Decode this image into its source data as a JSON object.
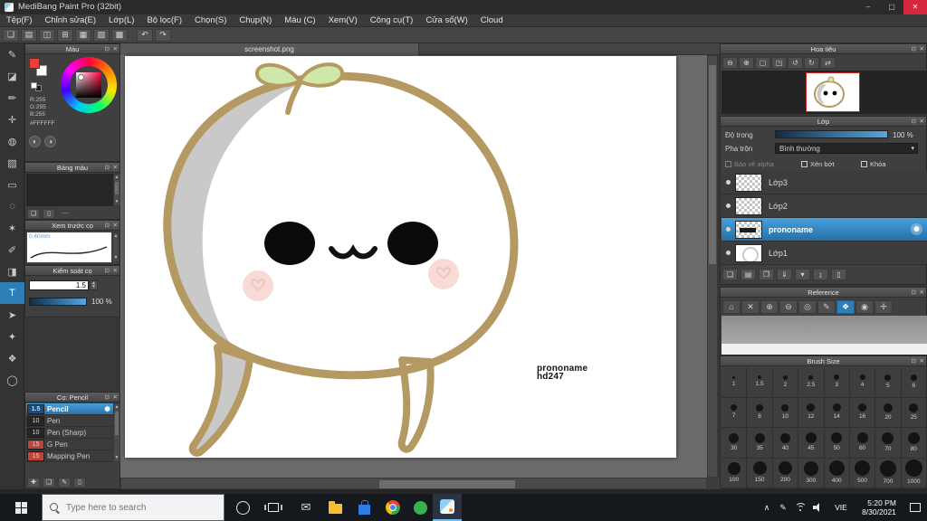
{
  "window": {
    "title": "MediBang Paint Pro (32bit)"
  },
  "icons": {
    "minimize": "–",
    "maximize": "▢",
    "close": "✕",
    "undo": "↶",
    "redo": "↷",
    "panel_float": "⊡",
    "panel_close": "✕",
    "gear": "✺",
    "dropdown": "▾",
    "scroll_up": "▲",
    "scroll_down": "▼",
    "color_wheel_mode": "◐",
    "color_bar_mode": "◑",
    "mail": "✉",
    "tray_expand": "∧",
    "tray_pen": "✎"
  },
  "menu_bar": {
    "items": [
      "Tệp(F)",
      "Chỉnh sửa(E)",
      "Lớp(L)",
      "Bộ lọc(F)",
      "Chọn(S)",
      "Chụp(N)",
      "Màu (C)",
      "Xem(V)",
      "Công cụ(T)",
      "Cửa sổ(W)",
      "Cloud"
    ]
  },
  "main_toolbar": {
    "icons": [
      {
        "name": "new-canvas-icon",
        "glyph": "❏"
      },
      {
        "name": "open-file-icon",
        "glyph": "▤"
      },
      {
        "name": "save-file-icon",
        "glyph": "◫"
      },
      {
        "name": "canvas-size-icon",
        "glyph": "⊞"
      },
      {
        "name": "grid-view-icon",
        "glyph": "▦"
      },
      {
        "name": "snap-grid-icon",
        "glyph": "▨"
      },
      {
        "name": "material-panel-icon",
        "glyph": "▩"
      }
    ]
  },
  "tools": {
    "items": [
      {
        "name": "brush-tool",
        "glyph": "✎"
      },
      {
        "name": "eraser-tool",
        "glyph": "◪"
      },
      {
        "name": "pen-tool",
        "glyph": "✏"
      },
      {
        "name": "move-tool",
        "glyph": "✛"
      },
      {
        "name": "fill-tool",
        "glyph": "◍"
      },
      {
        "name": "gradient-tool",
        "glyph": "▨"
      },
      {
        "name": "select-rect-tool",
        "glyph": "▭"
      },
      {
        "name": "lasso-tool",
        "glyph": "◌"
      },
      {
        "name": "magic-wand-tool",
        "glyph": "✶"
      },
      {
        "name": "select-pen-tool",
        "glyph": "✐"
      },
      {
        "name": "select-eraser-tool",
        "glyph": "◨"
      },
      {
        "name": "text-tool",
        "glyph": "T",
        "selected": true
      },
      {
        "name": "operation-tool",
        "glyph": "➤"
      },
      {
        "name": "eyedropper-tool",
        "glyph": "✦"
      },
      {
        "name": "hand-tool",
        "glyph": "❖"
      },
      {
        "name": "zoom-tool",
        "glyph": "◯"
      }
    ]
  },
  "color_panel": {
    "title": "Màu",
    "r": "R:255",
    "g": "G:255",
    "b": "B:255",
    "hex": "#FFFFFF"
  },
  "palette_panel": {
    "title": "Bảng màu",
    "empty_label": "---",
    "buttons": [
      {
        "name": "add-color-icon",
        "glyph": "❏"
      },
      {
        "name": "delete-color-icon",
        "glyph": "▯"
      }
    ]
  },
  "brush_preview_panel": {
    "title": "Xem trước cọ",
    "size_label": "0.40mm"
  },
  "brush_control_panel": {
    "title": "Kiểm soát cọ",
    "width_value": "1.5",
    "opacity_value": "100 %"
  },
  "brush_panel": {
    "title": "Cọ: Pencil",
    "brushes": [
      {
        "size": "1.5",
        "name": "Pencil",
        "selected": true,
        "chip": "#1c4e77"
      },
      {
        "size": "10",
        "name": "Pen",
        "chip": "#262626"
      },
      {
        "size": "10",
        "name": "Pen (Sharp)",
        "chip": "#262626"
      },
      {
        "size": "15",
        "name": "G Pen",
        "chip": "#c14438"
      },
      {
        "size": "15",
        "name": "Mapping Pen",
        "chip": "#c14438"
      }
    ],
    "buttons": [
      {
        "name": "add-brush-icon",
        "glyph": "✚"
      },
      {
        "name": "duplicate-brush-icon",
        "glyph": "❏"
      },
      {
        "name": "edit-brush-icon",
        "glyph": "✎"
      },
      {
        "name": "delete-brush-icon",
        "glyph": "▯"
      }
    ]
  },
  "canvas": {
    "tab": "screenshot.png",
    "signature_line1": "prononame",
    "signature_line2": "hd247"
  },
  "navigator_panel": {
    "title": "Hoa tiêu",
    "buttons": [
      {
        "name": "zoom-out-icon",
        "glyph": "⊖"
      },
      {
        "name": "zoom-in-icon",
        "glyph": "⊕"
      },
      {
        "name": "fit-window-icon",
        "glyph": "▢"
      },
      {
        "name": "actual-pixels-icon",
        "glyph": "◳"
      },
      {
        "name": "rotate-left-icon",
        "glyph": "↺"
      },
      {
        "name": "rotate-right-icon",
        "glyph": "↻"
      },
      {
        "name": "flip-horizontal-icon",
        "glyph": "⇄"
      }
    ]
  },
  "layer_panel": {
    "title": "Lớp",
    "opacity_label": "Độ trong",
    "opacity_value": "100 %",
    "blend_label": "Pha trộn",
    "blend_value": "Bình thường",
    "protect_alpha_label": "Bảo vệ alpha",
    "clipping_label": "Xén bớt",
    "lock_label": "Khóa",
    "layers": [
      {
        "name": "Lớp3",
        "thumb": "checker"
      },
      {
        "name": "Lớp2",
        "thumb": "checker"
      },
      {
        "name": "prononame",
        "thumb": "checker-ink",
        "selected": true
      },
      {
        "name": "Lớp1",
        "thumb": "sketch"
      }
    ],
    "buttons": [
      {
        "name": "add-layer-icon",
        "glyph": "❏"
      },
      {
        "name": "add-folder-icon",
        "glyph": "▤"
      },
      {
        "name": "duplicate-layer-icon",
        "glyph": "❐"
      },
      {
        "name": "merge-down-icon",
        "glyph": "⇓"
      },
      {
        "name": "layer-menu-icon",
        "glyph": "▾"
      },
      {
        "name": "reorder-layer-icon",
        "glyph": "↨"
      },
      {
        "name": "delete-layer-icon",
        "glyph": "▯"
      }
    ]
  },
  "reference_panel": {
    "title": "Reference",
    "buttons": [
      {
        "name": "home-icon",
        "glyph": "⌂"
      },
      {
        "name": "clear-icon",
        "glyph": "✕"
      },
      {
        "name": "zoom-in-icon",
        "glyph": "⊕"
      },
      {
        "name": "zoom-out-icon",
        "glyph": "⊖"
      },
      {
        "name": "reset-view-icon",
        "glyph": "◎"
      },
      {
        "name": "eyedropper-icon",
        "glyph": "✎"
      },
      {
        "name": "hand-icon",
        "glyph": "❖",
        "selected": true
      },
      {
        "name": "loupe-icon",
        "glyph": "◉"
      },
      {
        "name": "crosshair-icon",
        "glyph": "✛"
      }
    ]
  },
  "brush_size_panel": {
    "title": "Brush Size",
    "sizes": [
      "1",
      "1.5",
      "2",
      "2.5",
      "3",
      "4",
      "5",
      "6",
      "7",
      "8",
      "10",
      "12",
      "14",
      "16",
      "20",
      "25",
      "30",
      "35",
      "40",
      "45",
      "50",
      "60",
      "70",
      "80",
      "100",
      "150",
      "200",
      "300",
      "400",
      "500",
      "700",
      "1000"
    ]
  },
  "taskbar": {
    "search_placeholder": "Type here to search",
    "language": "VIE",
    "time": "5:20 PM",
    "date": "8/30/2021"
  }
}
